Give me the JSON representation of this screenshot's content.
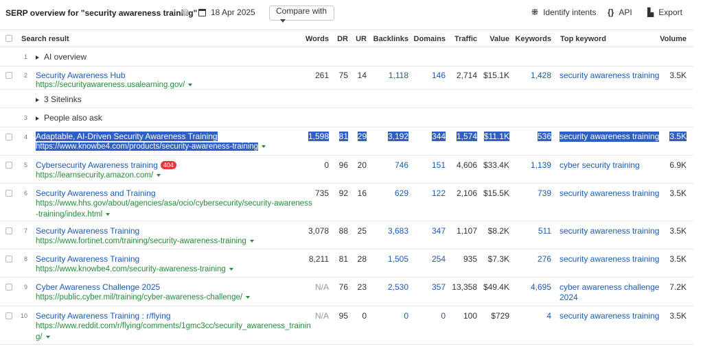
{
  "toolbar": {
    "title": "SERP overview for \"security awareness training\"",
    "date": "18 Apr 2025",
    "compare_label": "Compare with",
    "identify_label": "Identify intents",
    "api_label": "API",
    "export_label": "Export"
  },
  "columns": {
    "search_result": "Search result",
    "words": "Words",
    "dr": "DR",
    "ur": "UR",
    "backlinks": "Backlinks",
    "domains": "Domains",
    "traffic": "Traffic",
    "value": "Value",
    "keywords": "Keywords",
    "top_keyword": "Top keyword",
    "volume": "Volume"
  },
  "ai_overview": {
    "num": "1",
    "label": "AI overview"
  },
  "people_also_ask": {
    "num": "3",
    "label": "People also ask"
  },
  "sitelinks": {
    "label": "3 Sitelinks"
  },
  "rows": [
    {
      "num": "2",
      "title": "Security Awareness Hub",
      "url": "https://securityawareness.usalearning.gov/",
      "words": "261",
      "dr": "75",
      "ur": "14",
      "backlinks": "1,118",
      "domains": "146",
      "traffic": "2,714",
      "value": "$15.1K",
      "keywords": "1,428",
      "top_keyword": "security awareness training",
      "volume": "3.5K"
    },
    {
      "num": "4",
      "title": "Adaptable, AI-Driven Security Awareness Training",
      "url": "https://www.knowbe4.com/products/security-awareness-training",
      "words": "1,598",
      "dr": "81",
      "ur": "29",
      "backlinks": "3,192",
      "domains": "344",
      "traffic": "1,574",
      "value": "$11.1K",
      "keywords": "536",
      "top_keyword": "security awareness training",
      "volume": "3.5K"
    },
    {
      "num": "5",
      "title": "Cybersecurity Awareness training",
      "badge": "404",
      "url": "https://learnsecurity.amazon.com/",
      "words": "0",
      "dr": "96",
      "ur": "20",
      "backlinks": "746",
      "domains": "151",
      "traffic": "4,606",
      "value": "$33.4K",
      "keywords": "1,139",
      "top_keyword": "cyber security training",
      "volume": "6.9K"
    },
    {
      "num": "6",
      "title": "Security Awareness and Training",
      "url_line1": "https://www.hhs.gov/about/agencies/asa/ocio/cybersecurity/security-awareness",
      "url_line2": "-training/index.html",
      "words": "735",
      "dr": "92",
      "ur": "16",
      "backlinks": "629",
      "domains": "122",
      "traffic": "2,106",
      "value": "$15.5K",
      "keywords": "739",
      "top_keyword": "security awareness training",
      "volume": "3.5K"
    },
    {
      "num": "7",
      "title": "Security Awareness Training",
      "url": "https://www.fortinet.com/training/security-awareness-training",
      "words": "3,078",
      "dr": "88",
      "ur": "25",
      "backlinks": "3,683",
      "domains": "347",
      "traffic": "1,107",
      "value": "$8.2K",
      "keywords": "511",
      "top_keyword": "security awareness training",
      "volume": "3.5K"
    },
    {
      "num": "8",
      "title": "Security Awareness Training",
      "url": "https://www.knowbe4.com/security-awareness-training",
      "words": "8,211",
      "dr": "81",
      "ur": "28",
      "backlinks": "1,505",
      "domains": "254",
      "traffic": "935",
      "value": "$7.3K",
      "keywords": "276",
      "top_keyword": "security awareness training",
      "volume": "3.5K"
    },
    {
      "num": "9",
      "title": "Cyber Awareness Challenge 2025",
      "url": "https://public.cyber.mil/training/cyber-awareness-challenge/",
      "words": "N/A",
      "dr": "76",
      "ur": "23",
      "backlinks": "2,530",
      "domains": "357",
      "traffic": "13,358",
      "value": "$49.4K",
      "keywords": "4,695",
      "top_keyword_line1": "cyber awareness challenge",
      "top_keyword_line2": "2024",
      "volume": "7.2K"
    },
    {
      "num": "10",
      "title": "Security Awareness Training : r/flying",
      "url_line1": "https://www.reddit.com/r/flying/comments/1gmc3cc/security_awareness_trainin",
      "url_line2": "g/",
      "words": "N/A",
      "dr": "95",
      "ur": "0",
      "backlinks": "0",
      "domains": "0",
      "traffic": "100",
      "value": "$729",
      "keywords": "4",
      "top_keyword": "security awareness training",
      "volume": "3.5K"
    }
  ]
}
